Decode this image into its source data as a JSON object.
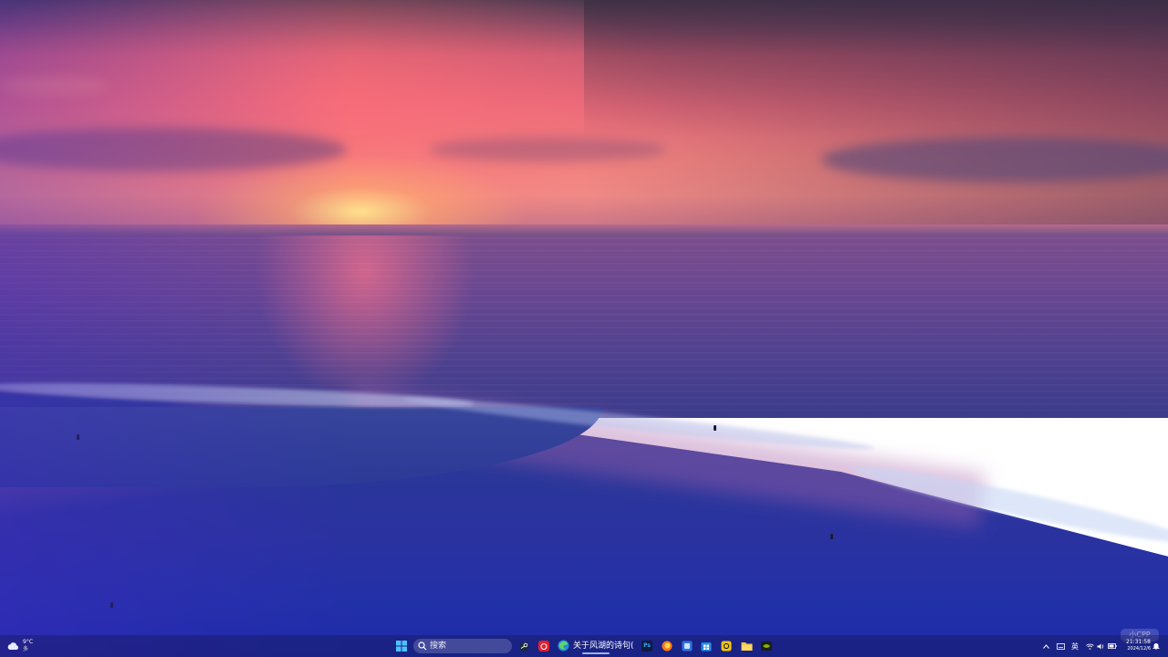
{
  "weather": {
    "temperature": "9°C",
    "condition": "多",
    "icon": "cloud-icon"
  },
  "taskbar": {
    "start_icon": "windows-start-icon",
    "search": {
      "placeholder": "搜索",
      "icon": "search-icon"
    },
    "apps": [
      {
        "name": "steam-icon"
      },
      {
        "name": "netease-music-icon"
      },
      {
        "name": "edge-browser-icon",
        "label": "关于风湖的诗句("
      },
      {
        "name": "photoshop-icon",
        "label": "Ps"
      },
      {
        "name": "firefox-icon"
      },
      {
        "name": "app-blue-icon"
      },
      {
        "name": "store-icon"
      },
      {
        "name": "app-yellow-icon"
      },
      {
        "name": "file-explorer-icon"
      },
      {
        "name": "nvidia-icon"
      }
    ],
    "accent": "#9bb0ff"
  },
  "tray": {
    "language": "英",
    "time": "21:31:58",
    "date": "2024/12/6",
    "icons": [
      "chevron-up-icon",
      "keyboard-icon",
      "wifi-icon",
      "volume-icon",
      "battery-icon",
      "notification-icon"
    ]
  },
  "watermark": "小CPP"
}
